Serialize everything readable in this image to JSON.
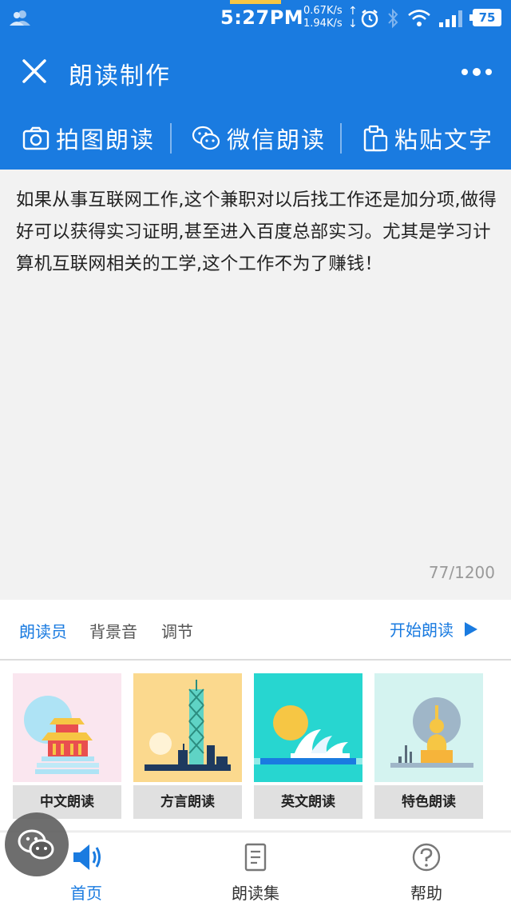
{
  "status_bar": {
    "time": "5:27PM",
    "speed_up": "0.67K/s",
    "speed_down": "1.94K/s",
    "battery": "75"
  },
  "header": {
    "title": "朗读制作"
  },
  "toolbar": {
    "items": [
      {
        "label": "拍图朗读",
        "icon": "camera-icon"
      },
      {
        "label": "微信朗读",
        "icon": "wechat-icon"
      },
      {
        "label": "粘贴文字",
        "icon": "clipboard-icon"
      }
    ]
  },
  "editor": {
    "text": "如果从事互联网工作,这个兼职对以后找工作还是加分项,做得好可以获得实习证明,甚至进入百度总部实习。尤其是学习计算机互联网相关的工学,这个工作不为了赚钱！",
    "char_count": "77/1200"
  },
  "options": {
    "reader": "朗读员",
    "background_music": "背景音",
    "adjust": "调节",
    "start": "开始朗读"
  },
  "cards": [
    {
      "label": "中文朗读"
    },
    {
      "label": "方言朗读"
    },
    {
      "label": "英文朗读"
    },
    {
      "label": "特色朗读"
    }
  ],
  "bottom_nav": {
    "items": [
      {
        "label": "首页",
        "icon": "speaker-icon"
      },
      {
        "label": "朗读集",
        "icon": "book-icon"
      },
      {
        "label": "帮助",
        "icon": "help-icon"
      }
    ]
  },
  "colors": {
    "primary": "#1a7be0",
    "background": "#f2f2f2"
  }
}
